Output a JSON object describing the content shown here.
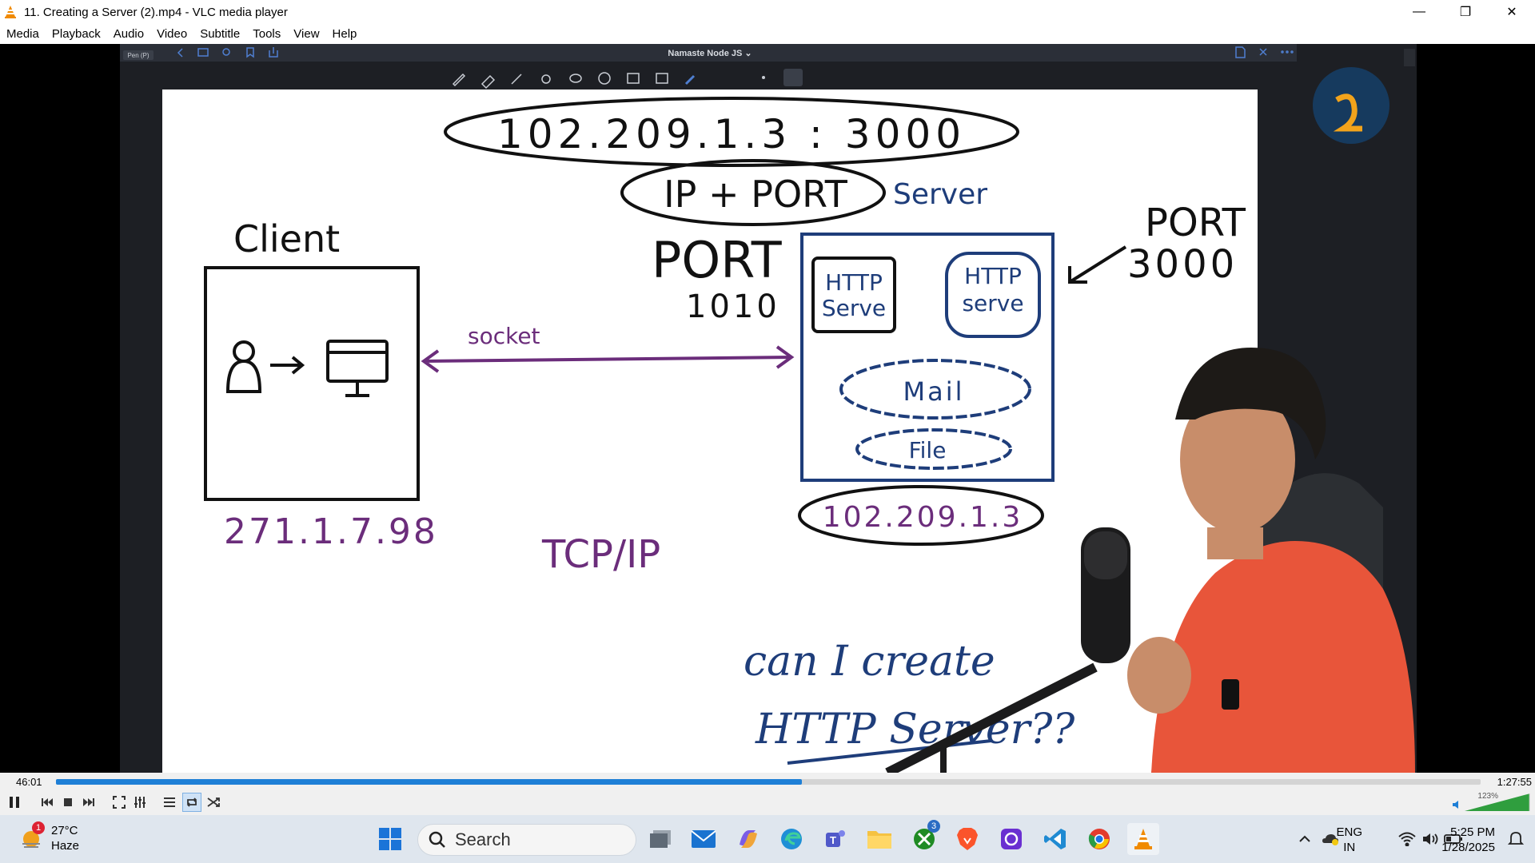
{
  "window": {
    "title": "11. Creating a Server (2).mp4 - VLC media player",
    "controls": [
      "minimize",
      "restore",
      "close"
    ]
  },
  "menu": [
    "Media",
    "Playback",
    "Audio",
    "Video",
    "Subtitle",
    "Tools",
    "View",
    "Help"
  ],
  "video": {
    "app_header": "Namaste Node JS ⌄",
    "pen_label": "Pen (P)",
    "whiteboard": {
      "top_address": "102.209.1.3 : 3000",
      "ip_port": "IP + PORT",
      "port_label": "PORT",
      "port_value": "1010",
      "client_label": "Client",
      "server_label": "Server",
      "port_3000": [
        "PORT",
        "3000"
      ],
      "socket": "socket",
      "http_server_1": [
        "HTTP",
        "Serve"
      ],
      "http_server_2": [
        "HTTP",
        "serve"
      ],
      "mail": "Mail",
      "file": "File",
      "server_ip": "102.209.1.3",
      "client_ip": "271.1.7.98",
      "tcp": "TCP/IP",
      "question_1": "can I create",
      "question_2": "HTTP Server??"
    }
  },
  "player": {
    "elapsed": "46:01",
    "duration": "1:27:55",
    "progress": 0.5236,
    "volume_label": "123%",
    "volume": 1.23
  },
  "taskbar": {
    "weather_temp": "27°C",
    "weather_desc": "Haze",
    "weather_badge": "1",
    "search_label": "Search",
    "xbox_badge": "3",
    "lang_1": "ENG",
    "lang_2": "IN",
    "time": "5:25 PM",
    "date": "1/28/2025"
  },
  "colors": {
    "accent": "#1e7fd6",
    "ink_black": "#111111",
    "ink_purple": "#6b2d7b",
    "ink_blue": "#1e3d7a",
    "shirt": "#e8553a"
  }
}
